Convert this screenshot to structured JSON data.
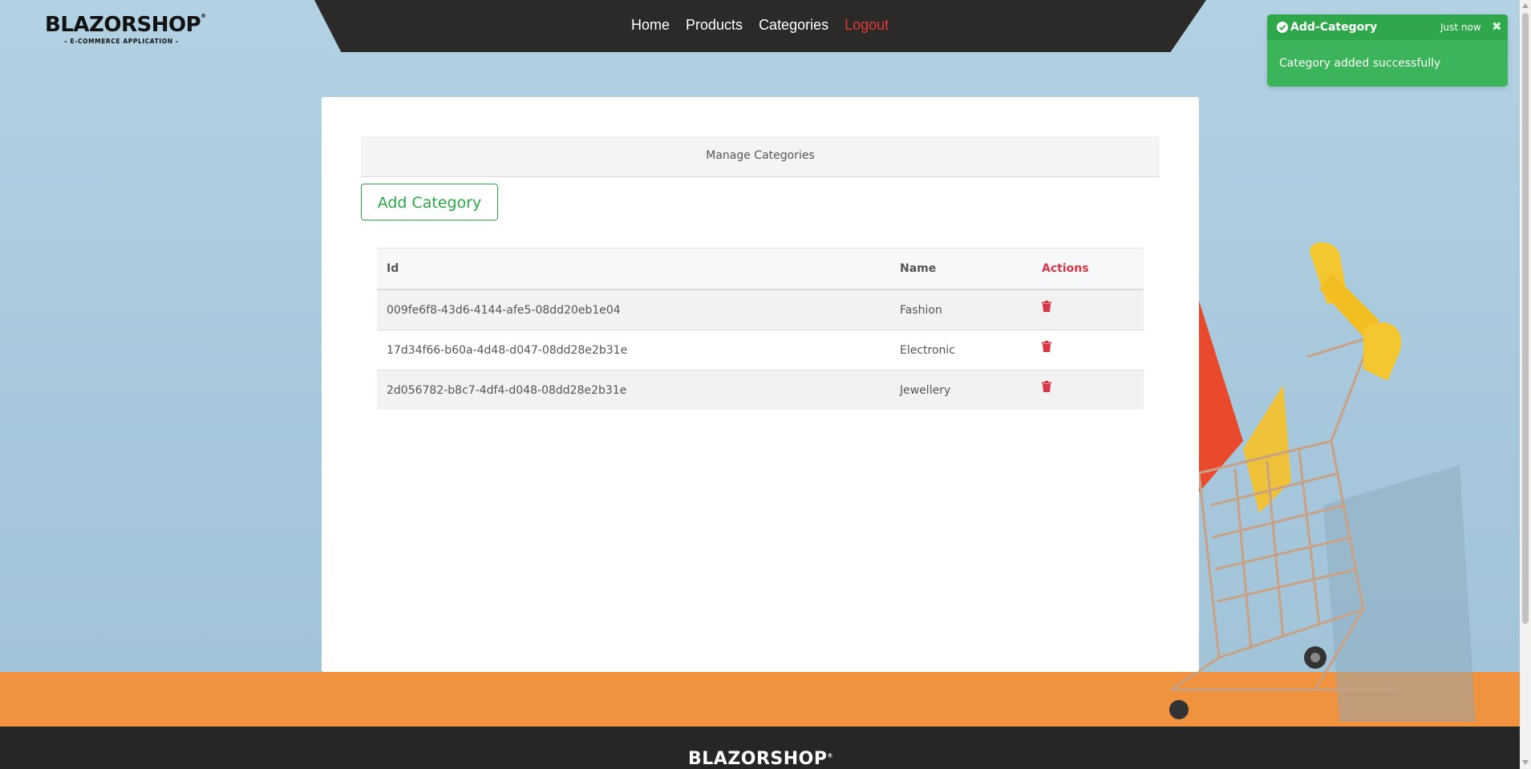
{
  "brand": {
    "name": "BLAZORSHOP",
    "tagline": "– E-COMMERCE APPLICATION –",
    "footer_name": "BLAZORSHOP"
  },
  "nav": {
    "items": [
      {
        "label": "Home"
      },
      {
        "label": "Products"
      },
      {
        "label": "Categories"
      },
      {
        "label": "Logout"
      }
    ]
  },
  "main": {
    "header": "Manage Categories",
    "add_button": "Add Category",
    "table": {
      "columns": [
        "Id",
        "Name",
        "Actions"
      ],
      "rows": [
        {
          "id": "009fe6f8-43d6-4144-afe5-08dd20eb1e04",
          "name": "Fashion",
          "action_icon": "trash-icon"
        },
        {
          "id": "17d34f66-b60a-4d48-d047-08dd28e2b31e",
          "name": "Electronic",
          "action_icon": "trash-icon"
        },
        {
          "id": "2d056782-b8c7-4df4-d048-08dd28e2b31e",
          "name": "Jewellery",
          "action_icon": "trash-icon"
        }
      ]
    }
  },
  "toast": {
    "title": "Add-Category",
    "time": "Just now",
    "close_icon": "close-icon",
    "message": "Category added successfully"
  },
  "colors": {
    "accent_green": "#28a745",
    "danger_red": "#dc3545",
    "navbar": "#2b2a29",
    "floor_orange": "#f0923e"
  }
}
